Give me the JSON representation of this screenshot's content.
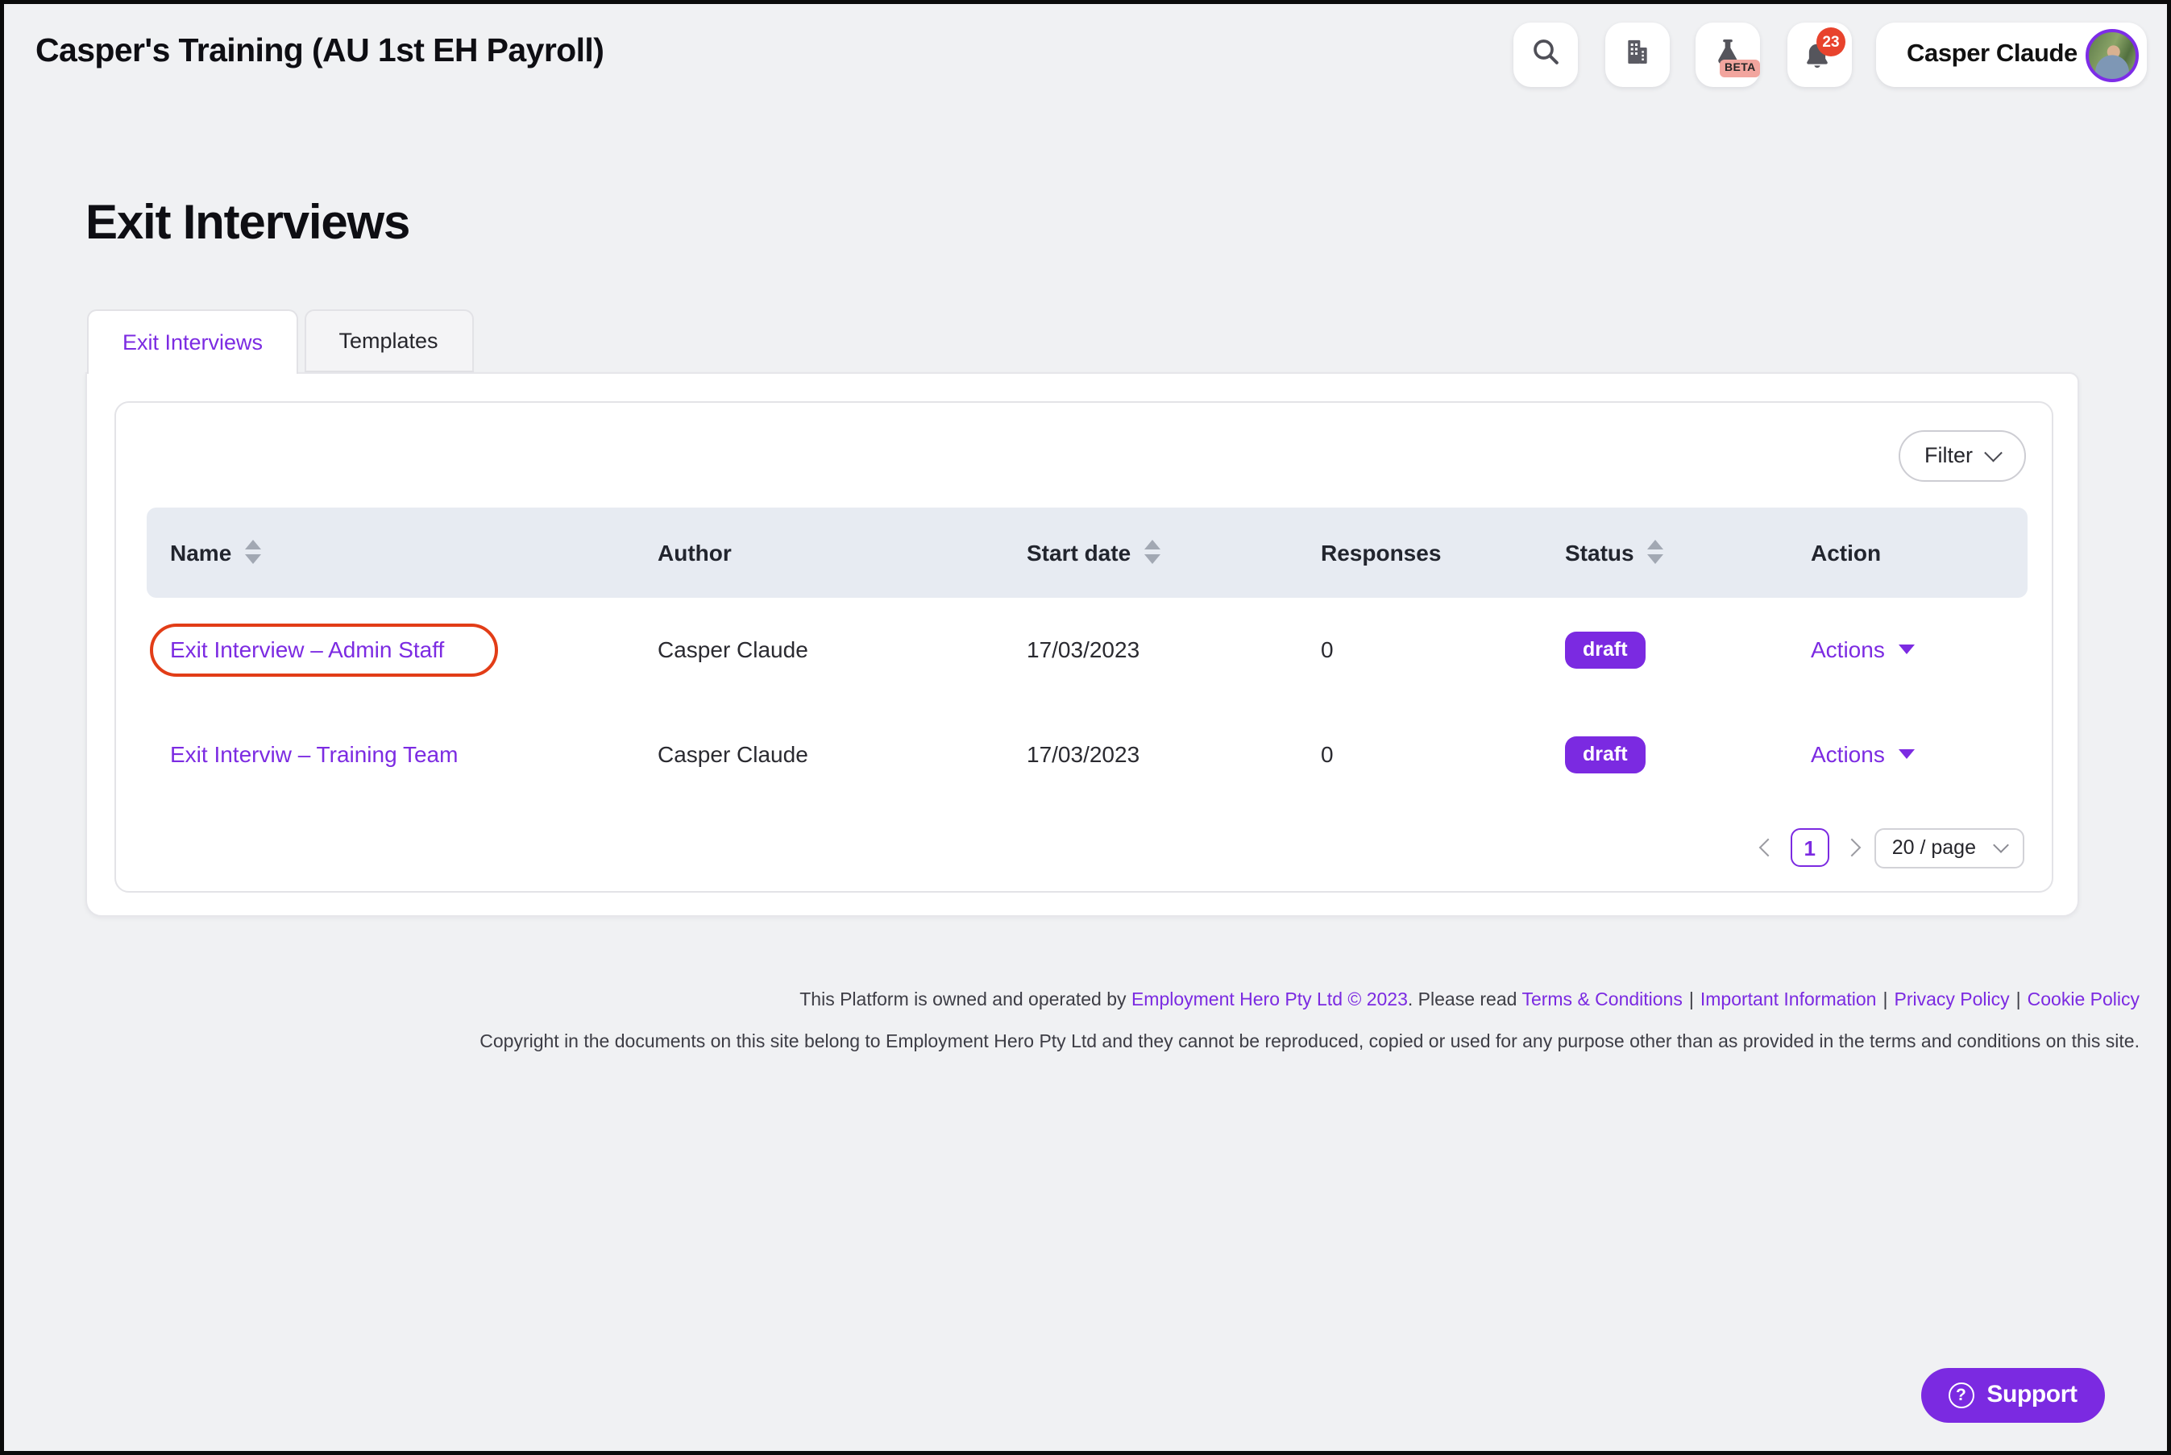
{
  "topbar": {
    "title": "Casper's Training (AU 1st EH Payroll)",
    "notification_count": "23",
    "beta_label": "BETA",
    "user_name": "Casper Claude",
    "icons": {
      "search": "magnifier",
      "organisation": "building",
      "labs": "flask",
      "notifications": "bell"
    }
  },
  "page": {
    "title": "Exit Interviews"
  },
  "tabs": [
    {
      "label": "Exit Interviews",
      "active": true
    },
    {
      "label": "Templates",
      "active": false
    }
  ],
  "toolbar": {
    "filter_label": "Filter"
  },
  "table": {
    "columns": [
      {
        "label": "Name",
        "sortable": true
      },
      {
        "label": "Author",
        "sortable": false
      },
      {
        "label": "Start date",
        "sortable": true
      },
      {
        "label": "Responses",
        "sortable": false
      },
      {
        "label": "Status",
        "sortable": true
      },
      {
        "label": "Action",
        "sortable": false
      }
    ],
    "rows": [
      {
        "name": "Exit Interview – Admin Staff",
        "author": "Casper Claude",
        "start_date": "17/03/2023",
        "responses": "0",
        "status": "draft",
        "action_label": "Actions",
        "annotated": true
      },
      {
        "name": "Exit Interviw – Training Team",
        "author": "Casper Claude",
        "start_date": "17/03/2023",
        "responses": "0",
        "status": "draft",
        "action_label": "Actions",
        "annotated": false
      }
    ]
  },
  "pagination": {
    "current_page": "1",
    "page_size": "20 / page"
  },
  "footer": {
    "line1_prefix": "This Platform is owned and operated by ",
    "line1_company": "Employment Hero Pty Ltd © 2023",
    "line1_middle": ". Please read ",
    "links": [
      "Terms & Conditions",
      "Important Information",
      "Privacy Policy",
      "Cookie Policy"
    ],
    "separator": "|",
    "line2": "Copyright in the documents on this site belong to Employment Hero Pty Ltd and they cannot be reproduced, copied or used for any purpose other than as provided in the terms and conditions on this site."
  },
  "support": {
    "label": "Support"
  },
  "colors": {
    "brand_purple": "#7b2ae1",
    "link_purple": "#7c2be2",
    "annotation_red": "#e23d17",
    "notification_red": "#e8432d",
    "beta_pink": "#f2a59e",
    "header_row_bg": "#e7ebf2",
    "page_bg": "#f0f1f3"
  }
}
